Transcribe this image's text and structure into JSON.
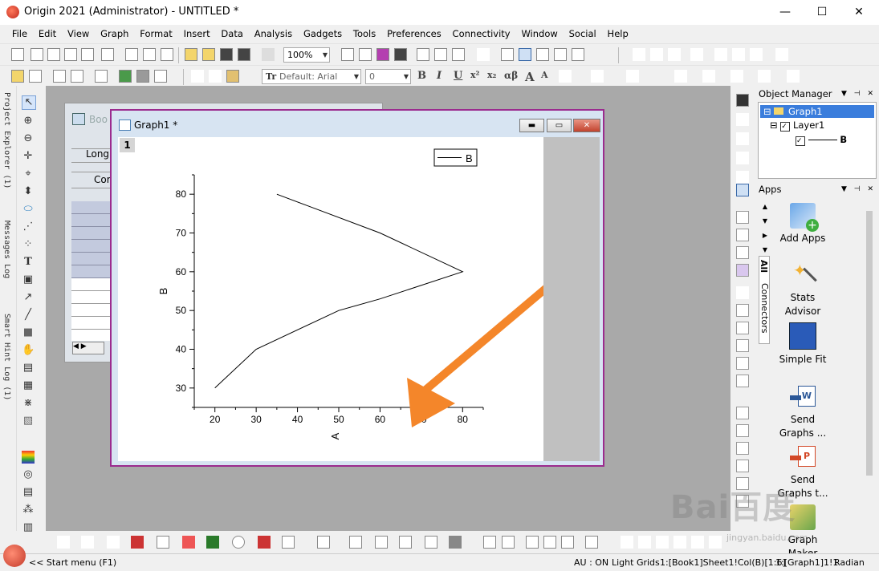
{
  "window": {
    "title": "Origin 2021 (Administrator) - UNTITLED *",
    "min_glyph": "—",
    "max_glyph": "☐",
    "close_glyph": "✕"
  },
  "menu": [
    "File",
    "Edit",
    "View",
    "Graph",
    "Format",
    "Insert",
    "Data",
    "Analysis",
    "Gadgets",
    "Tools",
    "Preferences",
    "Connectivity",
    "Window",
    "Social",
    "Help"
  ],
  "toolbar": {
    "zoom_value": "100%",
    "font_combo": "Default: Arial",
    "size_combo": "0",
    "bold": "B",
    "italic": "I",
    "underline": "U",
    "superscript": "x²",
    "subscript": "x₂",
    "greek": "αβ",
    "font_grow": "A",
    "font_shrink": "A"
  },
  "left_panels": {
    "project_explorer": "Project Explorer (1)",
    "messages_log": "Messages Log",
    "smart_hint_log": "Smart Hint Log (1)"
  },
  "book_window": {
    "title": "Boo",
    "row_long": "Long",
    "row_comm": "Com"
  },
  "graph_window": {
    "title": "Graph1 *",
    "layer_number": "1",
    "legend_label": "B"
  },
  "chart_data": {
    "type": "line",
    "x": [
      35,
      60,
      80,
      60,
      50,
      30,
      20
    ],
    "y": [
      80,
      70,
      60,
      53,
      50,
      40,
      30
    ],
    "series": [
      {
        "name": "B",
        "color": "#000000"
      }
    ],
    "xlabel": "A",
    "ylabel": "B",
    "xlim": [
      15,
      85
    ],
    "ylim": [
      25,
      85
    ],
    "xticks": [
      "20",
      "30",
      "40",
      "50",
      "60",
      "70",
      "80"
    ],
    "yticks": [
      "30",
      "40",
      "50",
      "60",
      "70",
      "80"
    ],
    "grid": false,
    "legend": "top-right",
    "annotation": {
      "type": "arrow",
      "color": "#f4862a"
    }
  },
  "object_manager": {
    "header": "Object Manager",
    "items": [
      "Graph1",
      "Layer1",
      "B"
    ]
  },
  "apps": {
    "header": "Apps",
    "tab_all": "All",
    "tab_connectors": "Connectors",
    "items": [
      {
        "label": "Add Apps",
        "icon": "add-apps-icon"
      },
      {
        "label": "Stats Advisor",
        "icon": "magic-wand-icon"
      },
      {
        "label": "Simple Fit",
        "icon": "fit-curve-icon"
      },
      {
        "label": "Send Graphs ...",
        "icon": "send-word-icon"
      },
      {
        "label": "Send Graphs t...",
        "icon": "send-ppt-icon"
      },
      {
        "label": "Graph Maker",
        "icon": "graph-maker-icon"
      }
    ]
  },
  "statusbar": {
    "start_menu": "<< Start menu (F1)",
    "au": "AU : ON",
    "grids": "Light Grids",
    "cell": "1:[Book1]Sheet1!Col(B)[1:6]",
    "layer": "1:[Graph1]1!1",
    "angle": "Radian"
  },
  "watermark": {
    "text": "Bai百度",
    "sub": "jingyan.baidu.com"
  }
}
